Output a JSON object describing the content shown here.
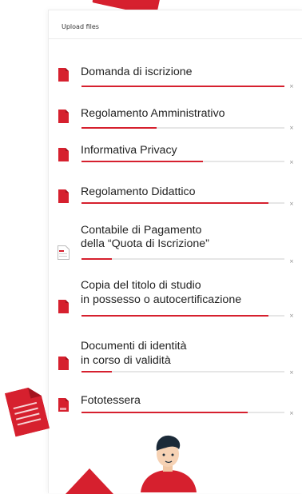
{
  "panel": {
    "title": "Upload files",
    "remove_label": "×"
  },
  "files": [
    {
      "name": "Domanda di iscrizione",
      "progress": 1.0,
      "icon": "pdf-file-icon"
    },
    {
      "name": "Regolamento Amministrativo",
      "progress": 0.37,
      "icon": "pdf-file-icon"
    },
    {
      "name": "Informativa Privacy",
      "progress": 0.6,
      "icon": "pdf-file-icon"
    },
    {
      "name": "Regolamento Didattico",
      "progress": 0.92,
      "icon": "pdf-file-icon"
    },
    {
      "name_line1": "Contabile di Pagamento",
      "name_line2": "della “Quota di Iscrizione”",
      "progress": 0.15,
      "icon": "blank-document-icon"
    },
    {
      "name_line1": "Copia del titolo di studio",
      "name_line2": "in possesso o autocertificazione",
      "progress": 0.92,
      "icon": "pdf-file-icon"
    },
    {
      "name_line1": "Documenti di identità",
      "name_line2": "in corso di validità",
      "progress": 0.15,
      "icon": "pdf-file-icon"
    },
    {
      "name": "Fototessera",
      "progress": 0.82,
      "icon": "jpg-file-icon"
    }
  ],
  "colors": {
    "accent": "#d6202e",
    "track": "#e6e6e6"
  }
}
